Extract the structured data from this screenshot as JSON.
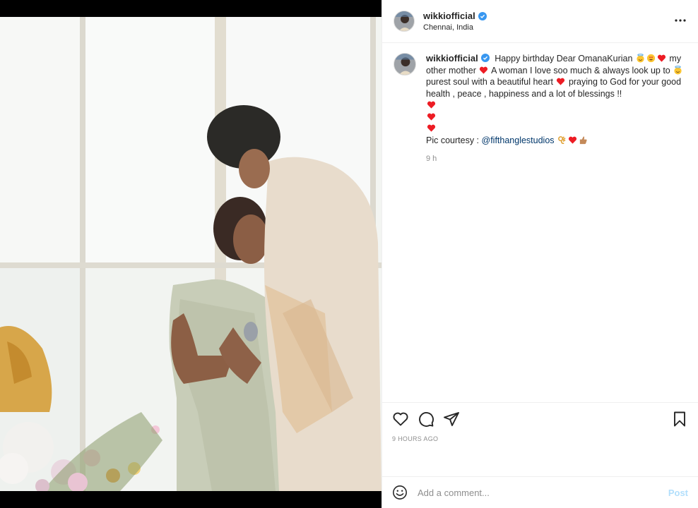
{
  "post": {
    "username": "wikkiofficial",
    "location": "Chennai, India",
    "image_alt": "Couple embracing in a bright room with flowers",
    "colors": {
      "verified": "#3897f0",
      "heart": "#ed1c24",
      "mention": "#00376b",
      "post_button": "#b2dffc"
    }
  },
  "caption": {
    "username": "wikkiofficial",
    "part1": "Happy birthday Dear OmanaKurian",
    "part2": "my other mother",
    "part3": "A woman I love soo much & always look up to",
    "part4": "purest soul with a beautiful heart",
    "part5": "praying to God for your good health , peace , happiness and a lot of blessings !!",
    "pic_courtesy": "Pic courtesy : ",
    "mention": "@fifthanglestudios",
    "time": "9 h"
  },
  "actions": {
    "icons": [
      "heart-icon",
      "comment-icon",
      "share-icon",
      "bookmark-icon"
    ],
    "time_ago": "9 HOURS AGO"
  },
  "comment_box": {
    "placeholder": "Add a comment...",
    "post_label": "Post"
  }
}
